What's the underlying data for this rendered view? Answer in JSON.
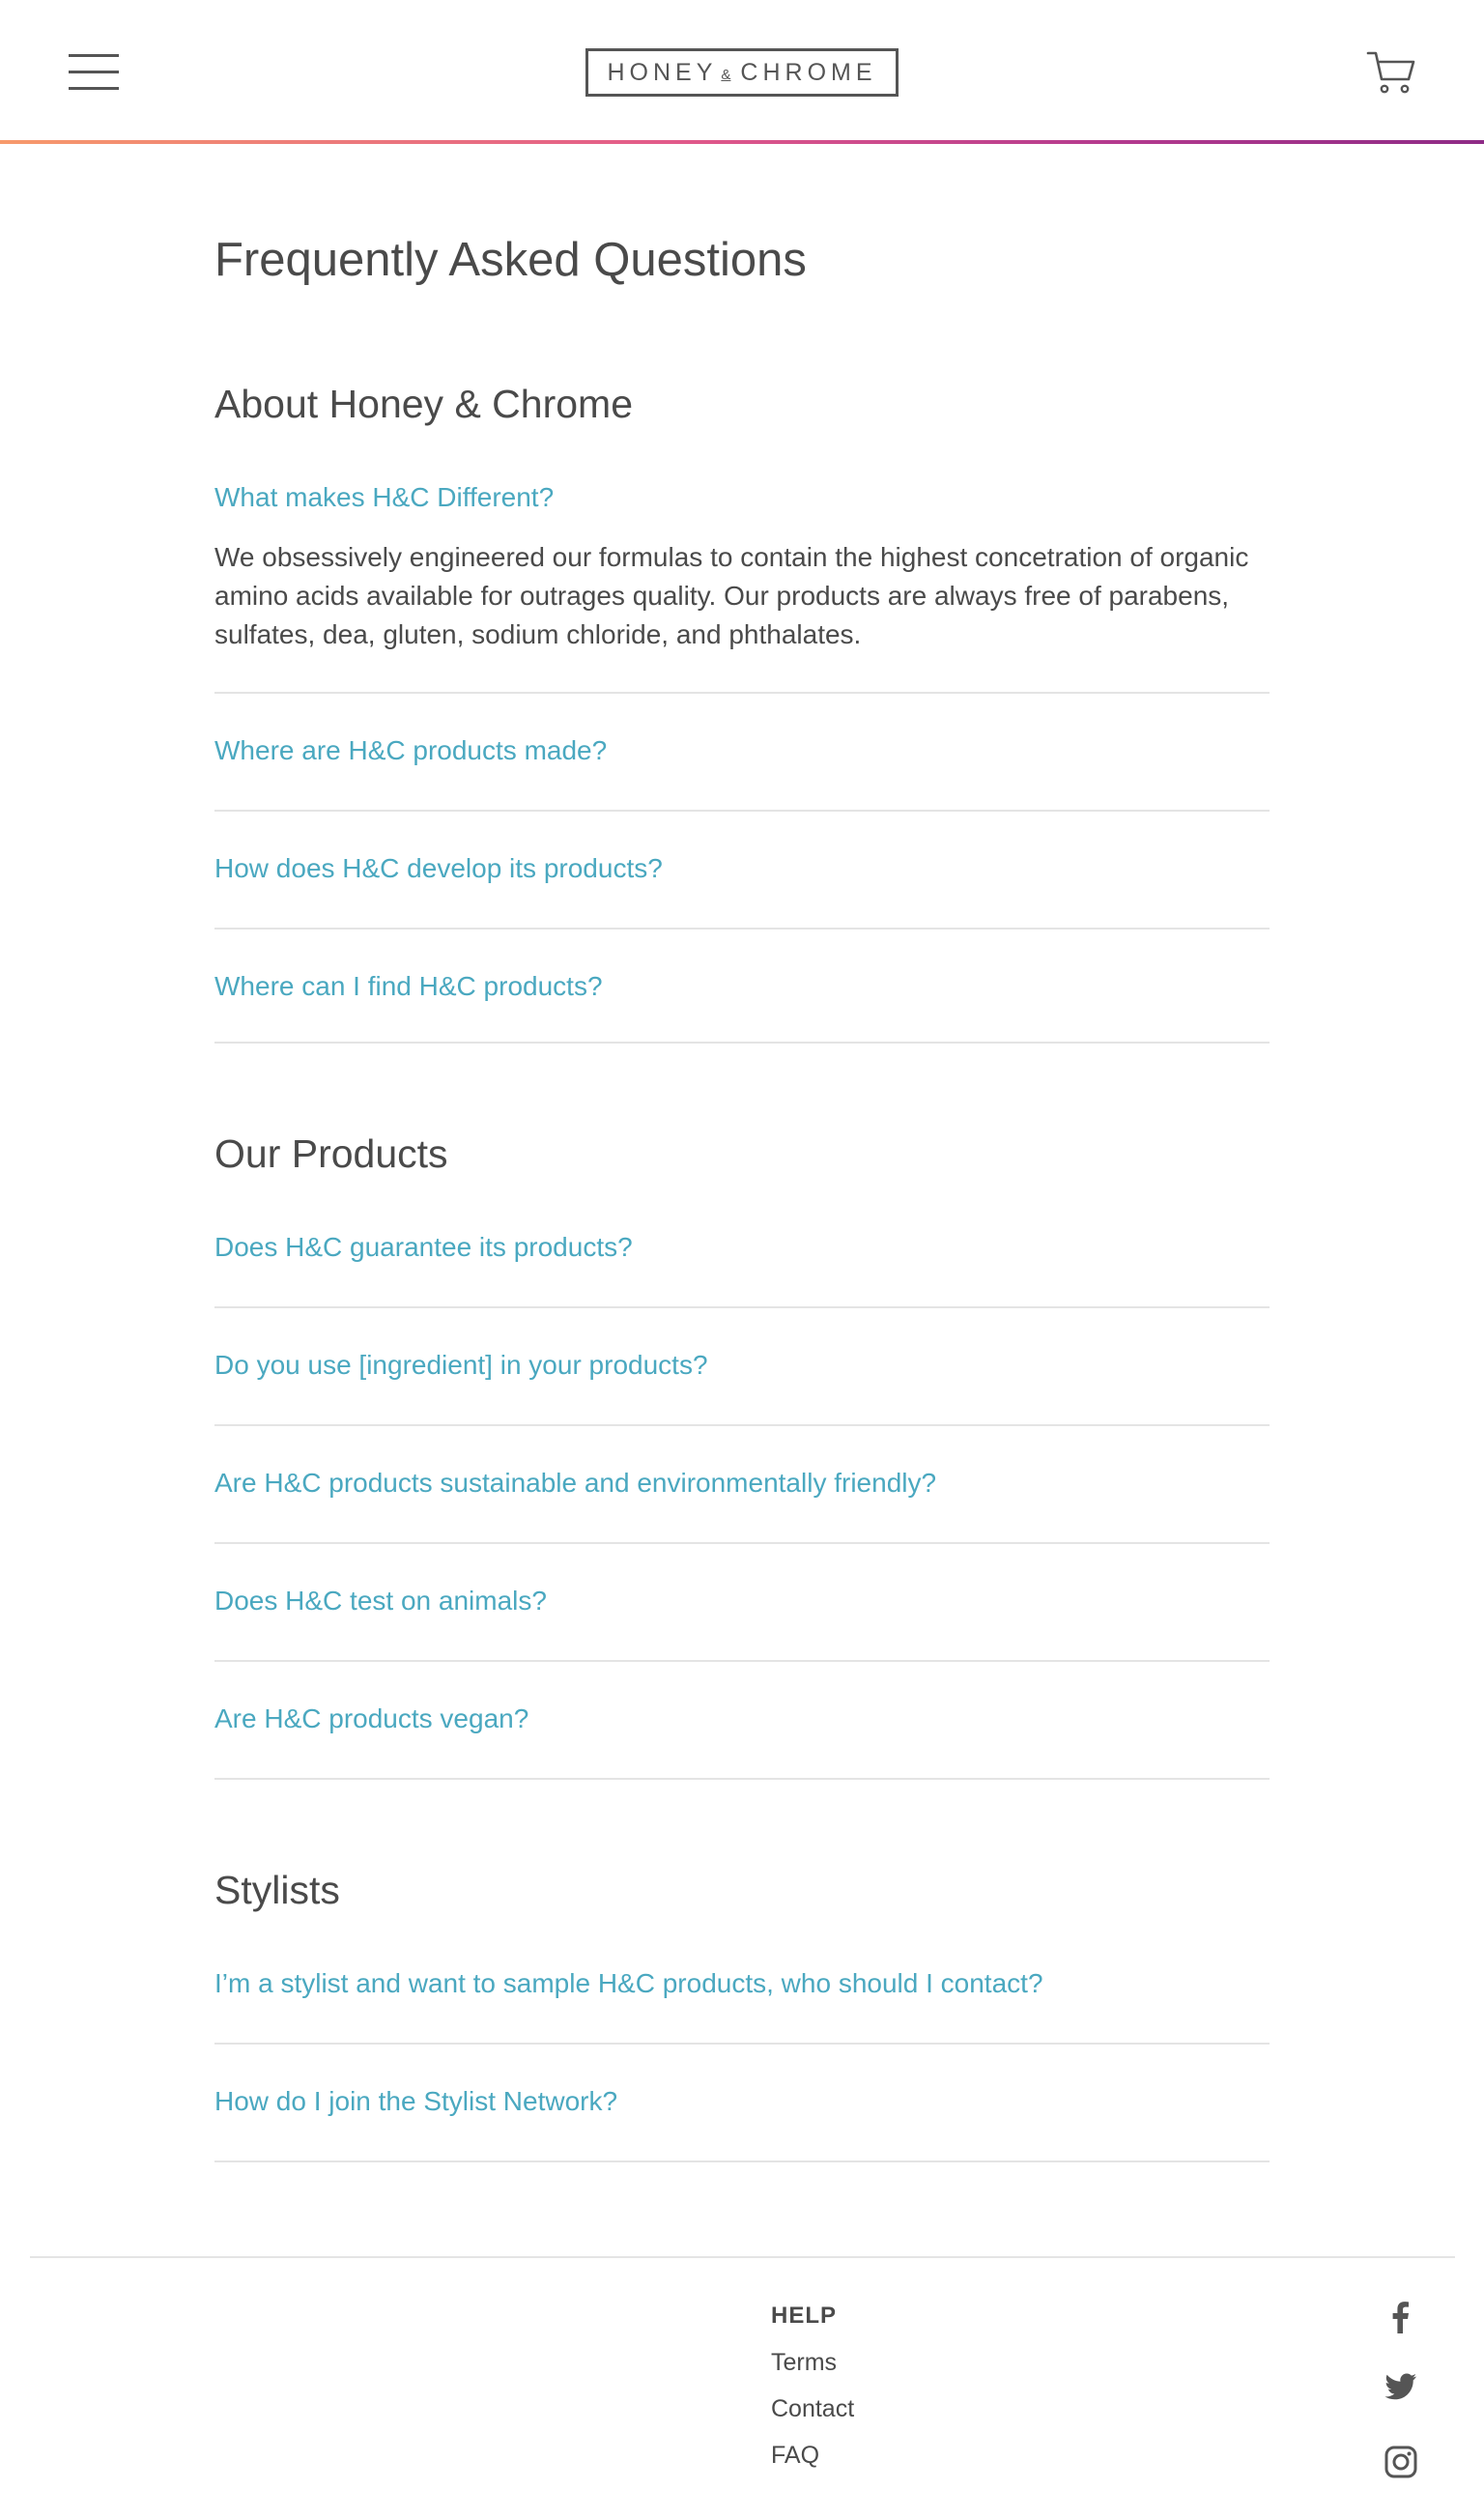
{
  "header": {
    "logo_left": "HONEY",
    "logo_amp": "&",
    "logo_right": "CHROME",
    "menu_icon": "hamburger-menu-icon",
    "cart_icon": "shopping-cart-icon",
    "accent_gradient": [
      "#f79a6b",
      "#e25a8a",
      "#b43a8e",
      "#8e2b86"
    ]
  },
  "main": {
    "title": "Frequently Asked Questions",
    "sections": [
      {
        "title": "About Honey & Chrome",
        "questions": [
          {
            "q": "What makes H&C Different?",
            "answer": "We obsessively engineered our formulas to contain the highest concetration of organic amino acids available for outrages quality. Our products are always free of parabens, sulfates, dea, gluten, sodium chloride, and phthalates."
          },
          {
            "q": "Where are H&C products made?"
          },
          {
            "q": "How does H&C develop its products?"
          },
          {
            "q": "Where can I find H&C products?"
          }
        ]
      },
      {
        "title": "Our Products",
        "questions": [
          {
            "q": "Does H&C guarantee its products?"
          },
          {
            "q": "Do you use [ingredient] in your products?"
          },
          {
            "q": "Are H&C products sustainable and environmentally friendly?"
          },
          {
            "q": "Does H&C test on animals?"
          },
          {
            "q": "Are H&C products vegan?"
          }
        ]
      },
      {
        "title": "Stylists",
        "questions": [
          {
            "q": "I’m a stylist and want to sample H&C products, who should I contact?"
          },
          {
            "q": "How do I join the Stylist Network?"
          }
        ]
      }
    ]
  },
  "footer": {
    "help_heading": "HELP",
    "links": [
      "Terms",
      "Contact",
      "FAQ"
    ],
    "social_icons": [
      "facebook-icon",
      "twitter-icon",
      "instagram-icon"
    ]
  },
  "colors": {
    "text": "#4a4a4a",
    "link": "#4aa8c0",
    "divider": "#e4e4e4"
  }
}
